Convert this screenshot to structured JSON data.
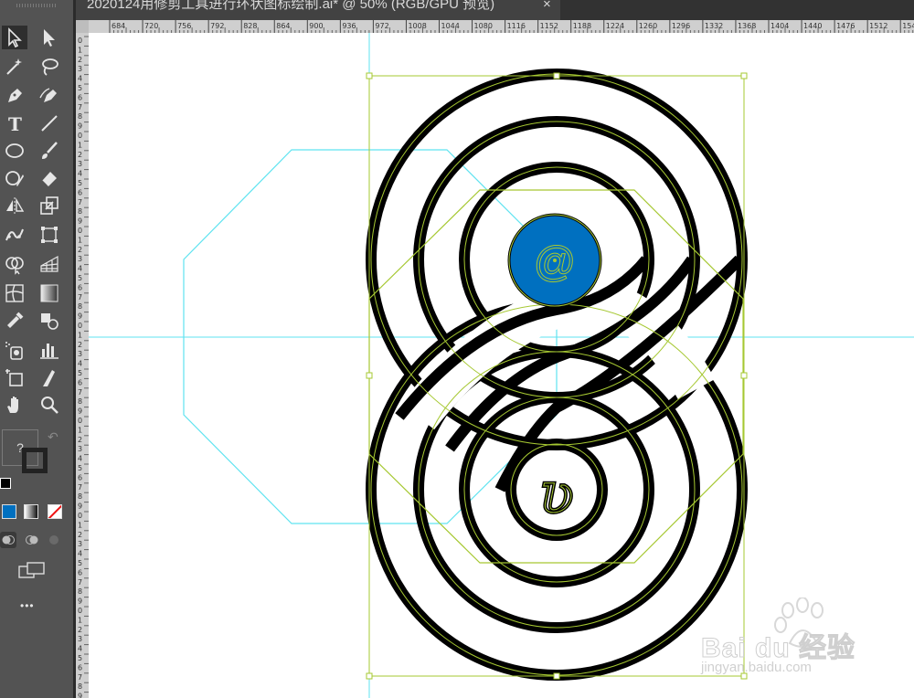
{
  "document": {
    "tab_title": "2020124用修剪工具进行环状图标绘制.ai* @ 50% (RGB/GPU 预览)",
    "close_label": "×"
  },
  "toolbar": {
    "tools": [
      "selection-tool",
      "direct-selection-tool",
      "magic-wand-tool",
      "lasso-tool",
      "pen-tool",
      "curvature-tool",
      "type-tool",
      "line-segment-tool",
      "ellipse-tool",
      "paintbrush-tool",
      "shaper-tool",
      "eraser-tool",
      "reflect-tool",
      "scale-tool",
      "puppet-warp-tool",
      "free-transform-tool",
      "shape-builder-tool",
      "perspective-grid-tool",
      "mesh-tool",
      "gradient-tool",
      "eyedropper-tool",
      "blend-tool",
      "symbol-sprayer-tool",
      "column-graph-tool",
      "artboard-tool",
      "slice-tool",
      "hand-tool",
      "zoom-tool"
    ],
    "fill_stroke_label": "?",
    "more_label": "•••",
    "fill_color": "#0070c0"
  },
  "rulers": {
    "top": [
      "684",
      "720",
      "756",
      "792",
      "828",
      "864",
      "900",
      "936",
      "972",
      "1008",
      "1044",
      "1080",
      "1116",
      "1152",
      "1188",
      "1224",
      "1260",
      "1296",
      "1332",
      "1368",
      "1404",
      "1440",
      "1476",
      "1512",
      "1548"
    ],
    "left": [
      "0",
      "1",
      "2",
      "3",
      "4",
      "5",
      "6",
      "7",
      "8",
      "9",
      "0",
      "1",
      "2",
      "3",
      "4",
      "5",
      "6",
      "7",
      "8",
      "9",
      "0",
      "1",
      "2",
      "3",
      "4",
      "5",
      "6",
      "7",
      "8",
      "9",
      "0",
      "1",
      "2",
      "3",
      "4",
      "5",
      "6",
      "7",
      "8",
      "9",
      "0",
      "1",
      "2",
      "3",
      "4",
      "5",
      "6",
      "7",
      "8",
      "9",
      "0",
      "1",
      "2",
      "3",
      "4",
      "5",
      "6",
      "7",
      "8",
      "9",
      "0",
      "1",
      "2",
      "3",
      "4",
      "5",
      "6",
      "7",
      "8",
      "9",
      "0"
    ]
  },
  "artwork": {
    "center_glyph": "@",
    "lower_glyph": "ʋ",
    "accent_color": "#0070c0",
    "selection_color": "#a6c832",
    "guide_color": "#5fe3f0"
  },
  "watermark": {
    "brand": "Bai du 经验",
    "url": "jingyan.baidu.com"
  }
}
